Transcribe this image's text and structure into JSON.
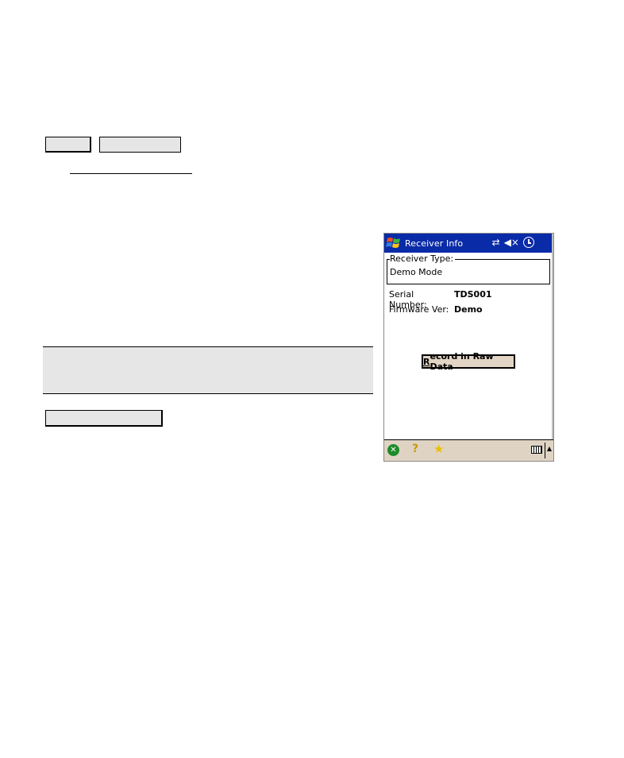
{
  "device": {
    "title": "Receiver Info",
    "tray_icons": [
      "connectivity-icon",
      "volume-muted-icon",
      "clock-icon"
    ],
    "receiver_type": {
      "legend": "Receiver Type:",
      "value": "Demo Mode"
    },
    "serial_number": {
      "label": "Serial Number:",
      "value": "TDS001"
    },
    "firmware": {
      "label": "Firmware Ver:",
      "value": "Demo"
    },
    "record_button": {
      "underlined": "R",
      "rest": "ecord in Raw Data"
    },
    "taskbar": {
      "ok_glyph": "✕",
      "help_glyph": "?",
      "fav_glyph": "★",
      "sip_arrow": "▲",
      "volume_glyph": "◀×",
      "sync_glyph": "⇄"
    }
  }
}
